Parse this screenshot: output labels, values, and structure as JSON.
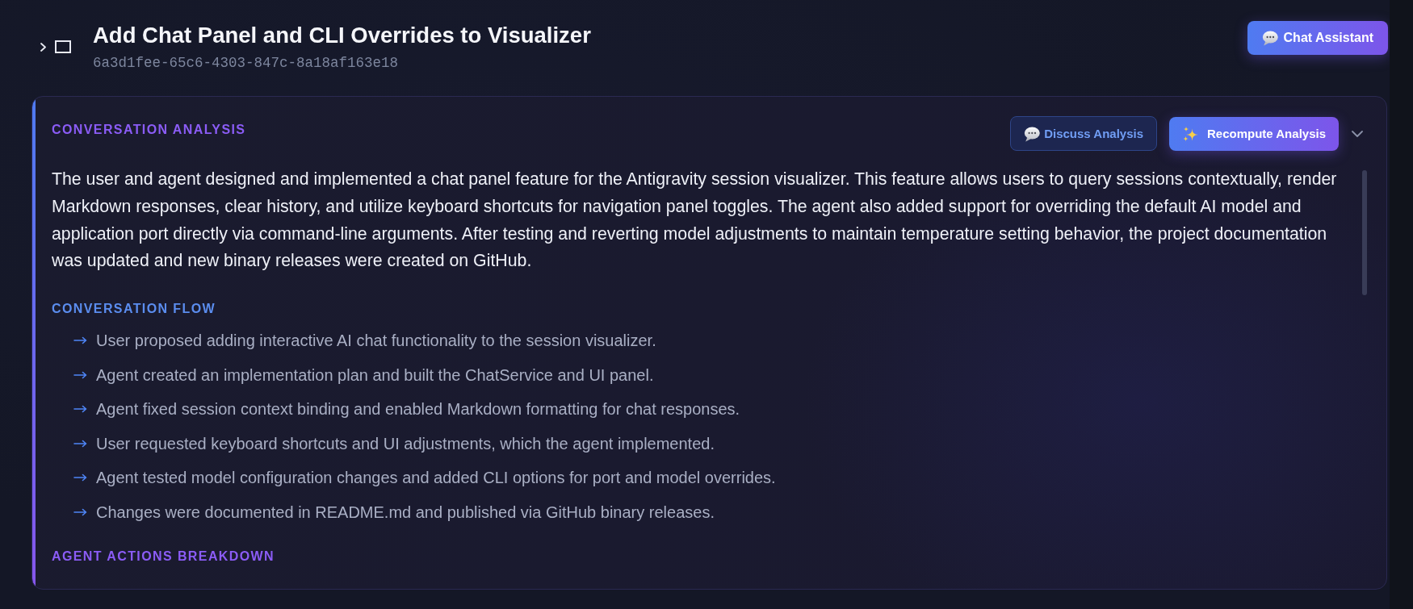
{
  "header": {
    "expanded": false,
    "title": "Add Chat Panel and CLI Overrides to Visualizer",
    "id": "6a3d1fee-65c6-4303-847c-8a18af163e18",
    "button": "Chat Assistant"
  },
  "analysis": {
    "heading": "CONVERSATION ANALYSIS",
    "expanded": true,
    "actions": [
      {
        "label": "Discuss Analysis",
        "kind": "discuss"
      },
      {
        "label": "Recompute Analysis",
        "kind": "recompute"
      }
    ],
    "summary": "The user and agent designed and implemented a chat panel feature for the Antigravity session visualizer. This feature allows users to query sessions contextually, render Markdown responses, clear history, and utilize keyboard shortcuts for navigation panel toggles. The agent also added support for overriding the default AI model and application port directly via command-line arguments. After testing and reverting model adjustments to maintain temperature setting behavior, the project documentation was updated and new binary releases were created on GitHub.",
    "flow": {
      "heading": "CONVERSATION FLOW",
      "items": [
        "User proposed adding interactive AI chat functionality to the session visualizer.",
        "Agent created an implementation plan and built the ChatService and UI panel.",
        "Agent fixed session context binding and enabled Markdown formatting for chat responses.",
        "User requested keyboard shortcuts and UI adjustments, which the agent implemented.",
        "Agent tested model configuration changes and added CLI options for port and model overrides.",
        "Changes were documented in README.md and published via GitHub binary releases."
      ]
    },
    "breakdown": {
      "heading": "AGENT ACTIONS BREAKDOWN"
    }
  }
}
